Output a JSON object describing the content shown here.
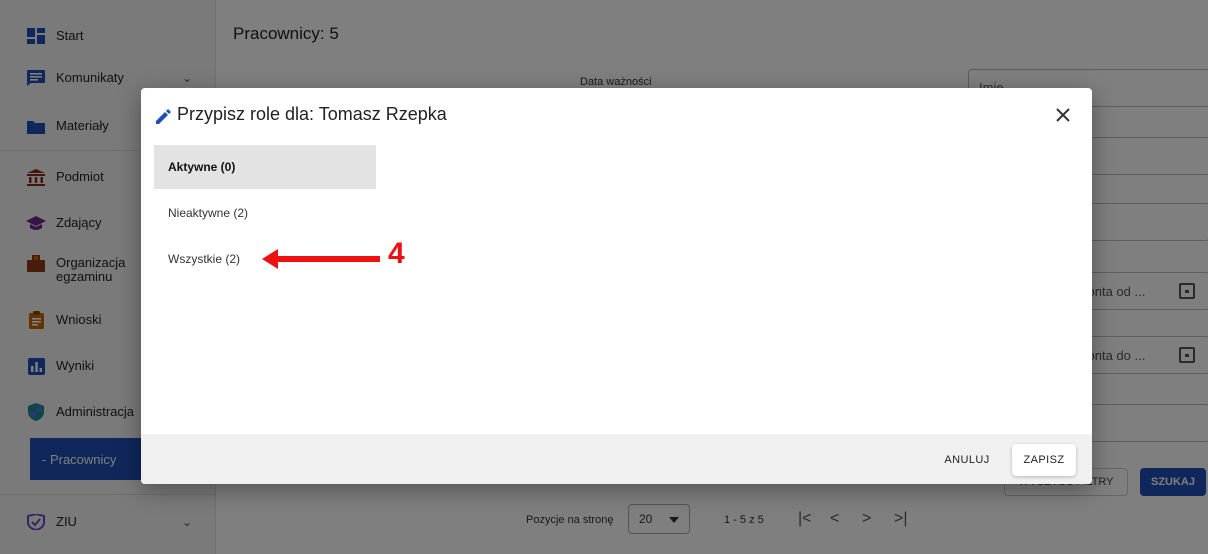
{
  "sidebar": {
    "items": [
      {
        "label": "Start",
        "icon": "dashboard-icon",
        "color": "#1e4fb7"
      },
      {
        "label": "Komunikaty",
        "icon": "message-icon",
        "color": "#1e4fb7"
      },
      {
        "label": "Materiały",
        "icon": "folder-icon",
        "color": "#1e4fb7"
      },
      {
        "label": "Podmiot",
        "icon": "institution-icon",
        "color": "#8a2d1e"
      },
      {
        "label": "Zdający",
        "icon": "graduation-cap-icon",
        "color": "#6a2a8c"
      },
      {
        "label": "Organizacja egzaminu",
        "icon": "briefcase-icon",
        "color": "#8a3a10"
      },
      {
        "label": "Wnioski",
        "icon": "clipboard-icon",
        "color": "#c46a00"
      },
      {
        "label": "Wyniki",
        "icon": "bar-chart-icon",
        "color": "#1e4fb7"
      },
      {
        "label": "Administracja",
        "icon": "shield-icon",
        "color": "#1a8c8c"
      }
    ],
    "active_sub": "- Pracownicy",
    "ziu": "ZIU"
  },
  "main": {
    "title": "Pracownicy: 5",
    "col_head_date": "Data ważności",
    "filters": {
      "imie": "Imię",
      "konta_od": "konta od ...",
      "konta_do": "konta do ..."
    },
    "clear_label": "WYCZYŚĆ FILTRY",
    "search_label": "SZUKAJ",
    "pager": {
      "label": "Pozycje na stronę",
      "value": "20",
      "range": "1 - 5 z 5",
      "first": "|<",
      "prev": "<",
      "next": ">",
      "last": ">|"
    }
  },
  "dialog": {
    "title": "Przypisz role dla: Tomasz Rzepka",
    "tabs": [
      {
        "label": "Aktywne (0)",
        "active": true
      },
      {
        "label": "Nieaktywne (2)",
        "active": false
      },
      {
        "label": "Wszystkie (2)",
        "active": false
      }
    ],
    "cancel_label": "ANULUJ",
    "save_label": "ZAPISZ"
  },
  "annotation": {
    "number": "4",
    "color": "#ee1111"
  }
}
